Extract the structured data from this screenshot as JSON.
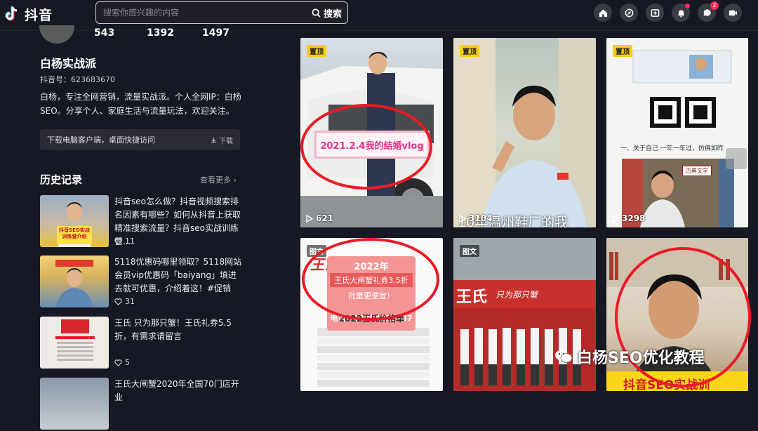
{
  "app": {
    "name": "抖音"
  },
  "search": {
    "placeholder": "搜索你感兴趣的内容",
    "button_label": "搜索"
  },
  "header_icons": [
    {
      "name": "home-icon"
    },
    {
      "name": "discover-icon"
    },
    {
      "name": "upload-icon"
    },
    {
      "name": "notification-icon",
      "dot": true
    },
    {
      "name": "message-icon",
      "badge": "2"
    },
    {
      "name": "live-icon"
    }
  ],
  "profile": {
    "stats": [
      "543",
      "1392",
      "1497"
    ],
    "name": "白杨实战派",
    "uid": "抖音号：623683670",
    "bio": "白杨，专注全网营销，流量实战派。个人全网IP：白杨SEO。分享个人、家庭生活与流量玩法，欢迎关注。",
    "download_text": "下载电脑客户端，桌面快捷访问",
    "download_button": "下载"
  },
  "history": {
    "title": "历史记录",
    "more": "查看更多",
    "items": [
      {
        "title": "抖音seo怎么做？抖音视频搜索排名因素有哪些？如何从抖音上获取精准搜索流量？抖音seo实战训练营...",
        "likes": "11",
        "thumb_text": "抖音SEO实战训练营介绍"
      },
      {
        "title": "5118优惠码哪里领取？5118网站会员vip优惠码「baiyang」填进去就可优惠，介绍着这！#促销",
        "likes": "31",
        "thumb_text": ""
      },
      {
        "title": "王氏 只为那只蟹！王氏礼券5.5折，有需求请留言",
        "likes": "5",
        "thumb_text": ""
      },
      {
        "title": "王氏大闸蟹2020年全国70门店开业",
        "likes": "",
        "thumb_text": ""
      }
    ]
  },
  "videos": [
    {
      "tag": "置顶",
      "plays": "621",
      "overlay_text": "2021.2.4我的结婚vlog"
    },
    {
      "tag": "置顶",
      "plays": "3104",
      "overlay_text": "10年温州鞋厂的我"
    },
    {
      "tag": "置顶",
      "plays": "3298",
      "overlay_text": "一、关于自己 一年一年过，仿佛如昨",
      "sub_text": "古典文学"
    },
    {
      "tag": "图文",
      "plays": "",
      "overlay_text": "王氏",
      "promo": [
        "2022年",
        "王氏大闸蟹礼券3.5折",
        "批量更便宜！",
        "电话：13754326987"
      ],
      "table_title": "2022王氏价格单"
    },
    {
      "tag": "图文",
      "plays": "",
      "overlay_text": "王氏",
      "sign": "只为那只蟹"
    },
    {
      "tag": "",
      "plays": "",
      "overlay_text": "抖音SEO实战训"
    }
  ],
  "watermark": "白杨SEO优化教程",
  "colors": {
    "bg": "#161823",
    "accent": "#fe2c55",
    "pin": "#facd15",
    "circle": "#ea1b26"
  }
}
